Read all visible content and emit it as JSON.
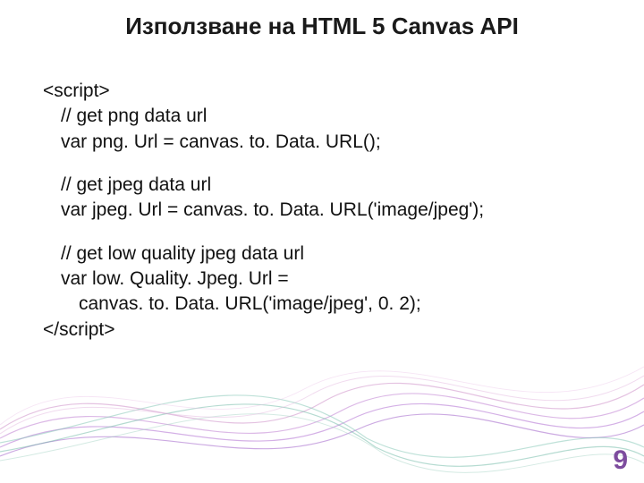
{
  "title": "Използване на HTML 5 Canvas API",
  "code": {
    "l1": "<script>",
    "l2": "// get png data url",
    "l3": "var png. Url = canvas. to. Data. URL();",
    "l4": "// get jpeg data url",
    "l5": "var jpeg. Url = canvas. to. Data. URL('image/jpeg');",
    "l6": "// get low quality jpeg data url",
    "l7": "var low. Quality. Jpeg. Url =",
    "l8": "canvas. to. Data. URL('image/jpeg', 0. 2);",
    "l9": "</script>"
  },
  "page_number": "9"
}
